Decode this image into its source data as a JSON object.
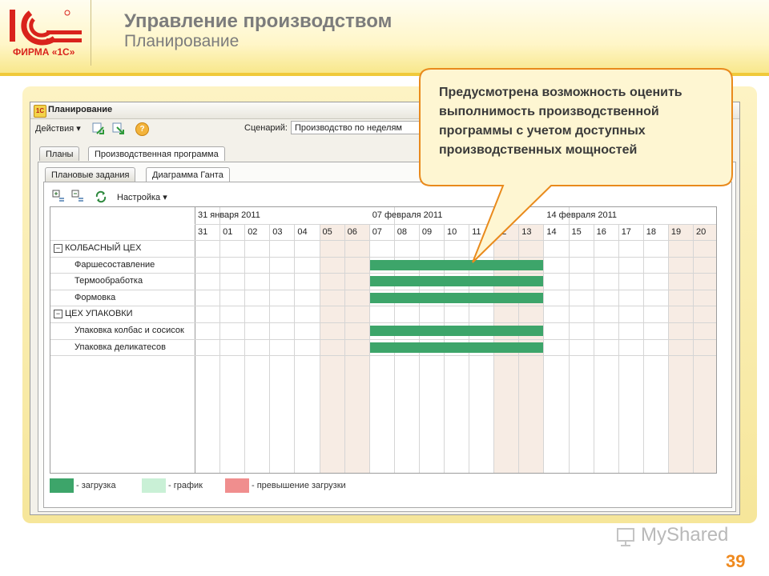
{
  "slide": {
    "title": "Управление производством",
    "subtitle": "Планирование",
    "logo_text": "ФИРМА «1С»",
    "page_number": "39",
    "watermark": "MyShared"
  },
  "window": {
    "title": "Планирование",
    "toolbar": {
      "actions_label": "Действия ▾",
      "help": "?",
      "scenario_label": "Сценарий:",
      "scenario_value": "Производство по неделям"
    },
    "tabs": [
      "Планы",
      "Производственная программа"
    ],
    "subtabs": [
      "Плановые задания",
      "Диаграмма Ганта"
    ],
    "gantt_toolbar": {
      "settings_label": "Настройка ▾"
    }
  },
  "gantt": {
    "weeks": [
      "31 января 2011",
      "07 февраля 2011",
      "14 февраля 2011"
    ],
    "days": [
      "31",
      "01",
      "02",
      "03",
      "04",
      "05",
      "06",
      "07",
      "08",
      "09",
      "10",
      "11",
      "12",
      "13",
      "14",
      "15",
      "16",
      "17",
      "18",
      "19",
      "20"
    ],
    "weekend_days": [
      "05",
      "06",
      "12",
      "13",
      "19",
      "20"
    ],
    "rows": [
      {
        "label": "КОЛБАСНЫЙ ЦЕХ",
        "group": true,
        "toggle": "−"
      },
      {
        "label": "Фаршесоставление",
        "group": false,
        "start": "07",
        "end": "13"
      },
      {
        "label": "Термообработка",
        "group": false,
        "start": "07",
        "end": "13"
      },
      {
        "label": "Формовка",
        "group": false,
        "start": "07",
        "end": "13"
      },
      {
        "label": "ЦЕХ УПАКОВКИ",
        "group": true,
        "toggle": "−"
      },
      {
        "label": "Упаковка колбас и сосисок",
        "group": false,
        "start": "07",
        "end": "13"
      },
      {
        "label": "Упаковка деликатесов",
        "group": false,
        "start": "07",
        "end": "13"
      }
    ]
  },
  "legend": [
    {
      "label": "- загрузка",
      "color": "#3da56a"
    },
    {
      "label": "- график",
      "color": "#c9f0d6"
    },
    {
      "label": "- превышение загрузки",
      "color": "#f08e8e"
    }
  ],
  "callout": {
    "lines": [
      "Предусмотрена возможность оценить",
      "выполнимость производственной",
      "программы с учетом доступных",
      "производственных мощностей"
    ]
  }
}
